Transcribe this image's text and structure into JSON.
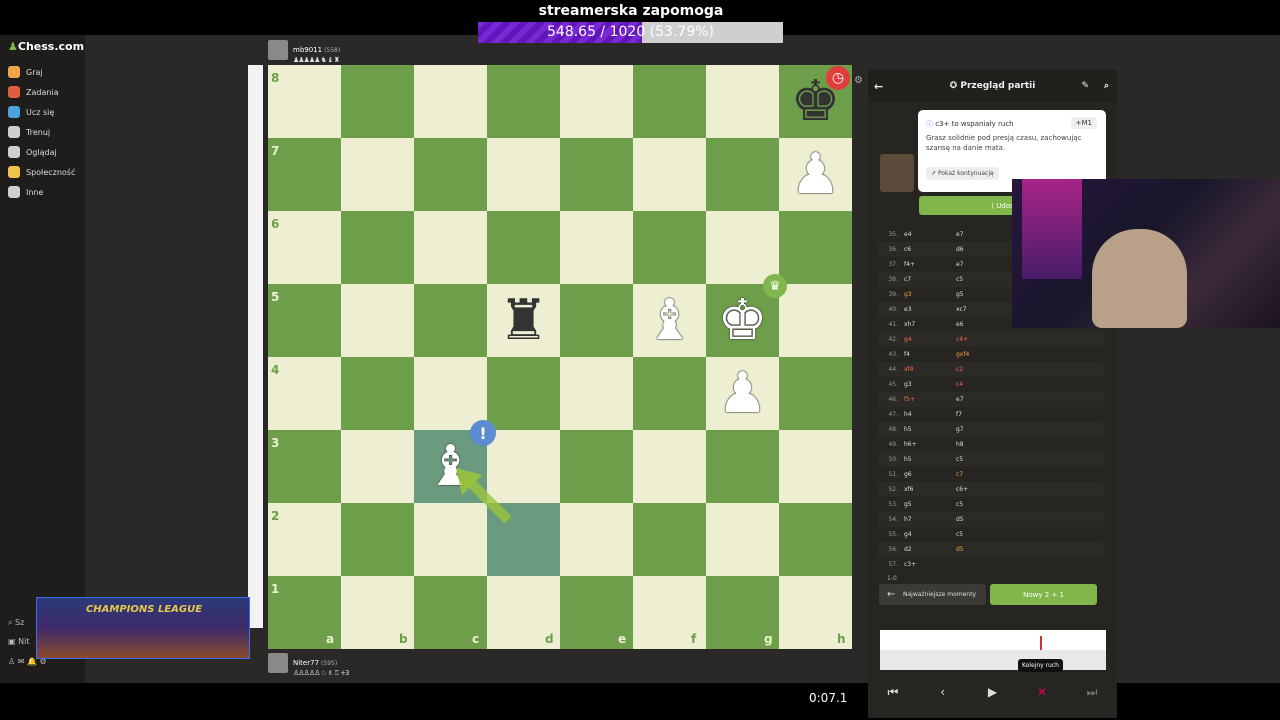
{
  "banner": {
    "title": "streamerska zapomoga",
    "progress_text": "548.65 / 1020 (53.79%)",
    "progress_fraction": 0.5379
  },
  "sidebar": {
    "logo": "Chess.com",
    "items": [
      {
        "label": "Graj",
        "icon": "pawn-play-icon",
        "color": "#f0a54a"
      },
      {
        "label": "Zadania",
        "icon": "puzzle-icon",
        "color": "#e05d3f"
      },
      {
        "label": "Ucz się",
        "icon": "graduation-cap-icon",
        "color": "#4aa3df"
      },
      {
        "label": "Trenuj",
        "icon": "target-icon",
        "color": "#cfcfcf"
      },
      {
        "label": "Oglądaj",
        "icon": "binoculars-icon",
        "color": "#cfcfcf"
      },
      {
        "label": "Społeczność",
        "icon": "people-icon",
        "color": "#f0c24a"
      },
      {
        "label": "Inne",
        "icon": "more-dots-icon",
        "color": "#cfcfcf"
      }
    ],
    "bottom": [
      "Sz",
      "Nit"
    ]
  },
  "top_player": {
    "name": "mb9011",
    "rating": "(558)",
    "captured": "♟♟♟♟♟ ♞ ♝ ♜"
  },
  "bottom_player": {
    "name": "Niter77",
    "rating": "(595)",
    "captured": "♙♙♙♙♙ ♘ ♗ ♖",
    "extra": "+3",
    "clock": "0:07.1"
  },
  "board": {
    "ranks": [
      "8",
      "7",
      "6",
      "5",
      "4",
      "3",
      "2",
      "1"
    ],
    "files": [
      "a",
      "b",
      "c",
      "d",
      "e",
      "f",
      "g",
      "h"
    ],
    "pieces": [
      {
        "sq": "h8",
        "glyph": "♚",
        "color": "b"
      },
      {
        "sq": "h7",
        "glyph": "♟",
        "color": "w"
      },
      {
        "sq": "d5",
        "glyph": "♜",
        "color": "b"
      },
      {
        "sq": "f5",
        "glyph": "♝",
        "color": "w"
      },
      {
        "sq": "g5",
        "glyph": "♚",
        "color": "w"
      },
      {
        "sq": "g4",
        "glyph": "♟",
        "color": "w"
      },
      {
        "sq": "c3",
        "glyph": "♝",
        "color": "w"
      }
    ],
    "highlight": [
      "c3",
      "d2"
    ],
    "move_badge": "!",
    "clock_badge": "clock-icon",
    "crown_badge": "crown-icon"
  },
  "panel": {
    "title": "Przegląd partii",
    "bubble_title": "c3+ to wspaniały ruch",
    "bubble_badge": "+M1",
    "bubble_desc": "Grasz solidnie pod presją czasu, zachowując szansę na danie mata.",
    "show_continuation": "Pokaż kontynuację",
    "share": "Udostępnij",
    "moves": [
      {
        "n": "35.",
        "w": "e4",
        "b": "e7"
      },
      {
        "n": "36.",
        "w": "c6",
        "b": "d6"
      },
      {
        "n": "37.",
        "w": "f4+",
        "b": "e7"
      },
      {
        "n": "38.",
        "w": "c7",
        "b": "c5"
      },
      {
        "n": "39.",
        "w": "g3",
        "b": "g5"
      },
      {
        "n": "40.",
        "w": "e3",
        "b": "xc7"
      },
      {
        "n": "41.",
        "w": "xh7",
        "b": "e6"
      },
      {
        "n": "42.",
        "w": "g4",
        "b": "c4+"
      },
      {
        "n": "43.",
        "w": "f4",
        "b": "gxf4"
      },
      {
        "n": "44.",
        "w": "xf4",
        "b": "c2"
      },
      {
        "n": "45.",
        "w": "g3",
        "b": "c4"
      },
      {
        "n": "46.",
        "w": "f5+",
        "b": "e7"
      },
      {
        "n": "47.",
        "w": "h4",
        "b": "f7"
      },
      {
        "n": "48.",
        "w": "h5",
        "b": "g7"
      },
      {
        "n": "49.",
        "w": "h6+",
        "b": "h8"
      },
      {
        "n": "50.",
        "w": "h5",
        "b": "c5"
      },
      {
        "n": "51.",
        "w": "g6",
        "b": "c7"
      },
      {
        "n": "52.",
        "w": "xf6",
        "b": "c6+"
      },
      {
        "n": "53.",
        "w": "g5",
        "b": "c5"
      },
      {
        "n": "54.",
        "w": "h7",
        "b": "d5"
      },
      {
        "n": "55.",
        "w": "g4",
        "b": "c5"
      },
      {
        "n": "56.",
        "w": "d2",
        "b": "d5"
      },
      {
        "n": "57.",
        "w": "c3+",
        "b": ""
      }
    ],
    "result": "1-0",
    "key_moments": "Najważniejsze momenty",
    "new_game": "Nowy 2 + 1",
    "tooltip": "Kolejny ruch"
  },
  "overlay": {
    "champions_league": "CHAMPIONS LEAGUE"
  }
}
